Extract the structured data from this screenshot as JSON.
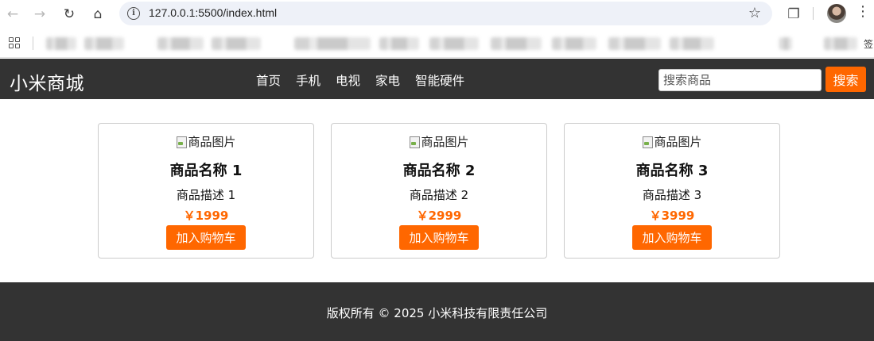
{
  "browser": {
    "url": "127.0.0.1:5500/index.html",
    "bookmark_tail": "签"
  },
  "site": {
    "logo": "小米商城",
    "nav": [
      "首页",
      "手机",
      "电视",
      "家电",
      "智能硬件"
    ],
    "search": {
      "placeholder": "搜索商品",
      "button": "搜索"
    },
    "accent_color": "#ff6700",
    "header_color": "#333333"
  },
  "products": [
    {
      "image_alt": "商品图片",
      "name": "商品名称 1",
      "desc": "商品描述 1",
      "price": "￥1999",
      "button": "加入购物车"
    },
    {
      "image_alt": "商品图片",
      "name": "商品名称 2",
      "desc": "商品描述 2",
      "price": "￥2999",
      "button": "加入购物车"
    },
    {
      "image_alt": "商品图片",
      "name": "商品名称 3",
      "desc": "商品描述 3",
      "price": "￥3999",
      "button": "加入购物车"
    }
  ],
  "footer": {
    "copyright": "版权所有 © 2025 小米科技有限责任公司"
  }
}
